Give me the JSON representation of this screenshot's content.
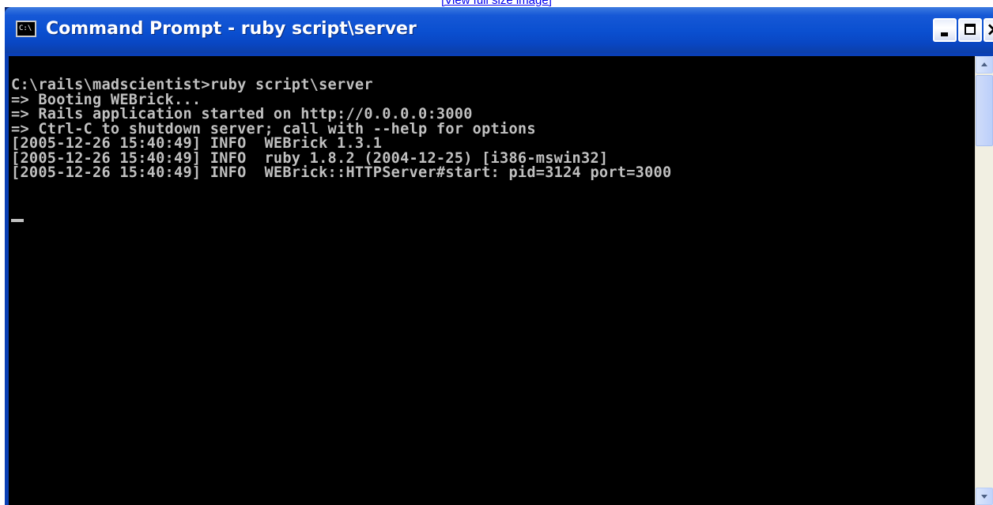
{
  "top_link": {
    "label": "[View full size image]"
  },
  "window": {
    "title": "Command Prompt - ruby script\\server",
    "icon_text": "C:\\",
    "icon": "console-icon",
    "buttons": {
      "minimize_icon": "minimize-icon",
      "maximize_icon": "maximize-icon",
      "close_icon": "close-icon",
      "close_glyph": "×"
    }
  },
  "console": {
    "lines": [
      "C:\\rails\\madscientist>ruby script\\server",
      "=> Booting WEBrick...",
      "=> Rails application started on http://0.0.0.0:3000",
      "=> Ctrl-C to shutdown server; call with --help for options",
      "[2005-12-26 15:40:49] INFO  WEBrick 1.3.1",
      "[2005-12-26 15:40:49] INFO  ruby 1.8.2 (2004-12-25) [i386-mswin32]",
      "[2005-12-26 15:40:49] INFO  WEBrick::HTTPServer#start: pid=3124 port=3000"
    ]
  },
  "colors": {
    "titlebar": "#0a4fd0",
    "console_background": "#000000",
    "console_text": "#c0c0c0",
    "link": "#0000ee"
  }
}
